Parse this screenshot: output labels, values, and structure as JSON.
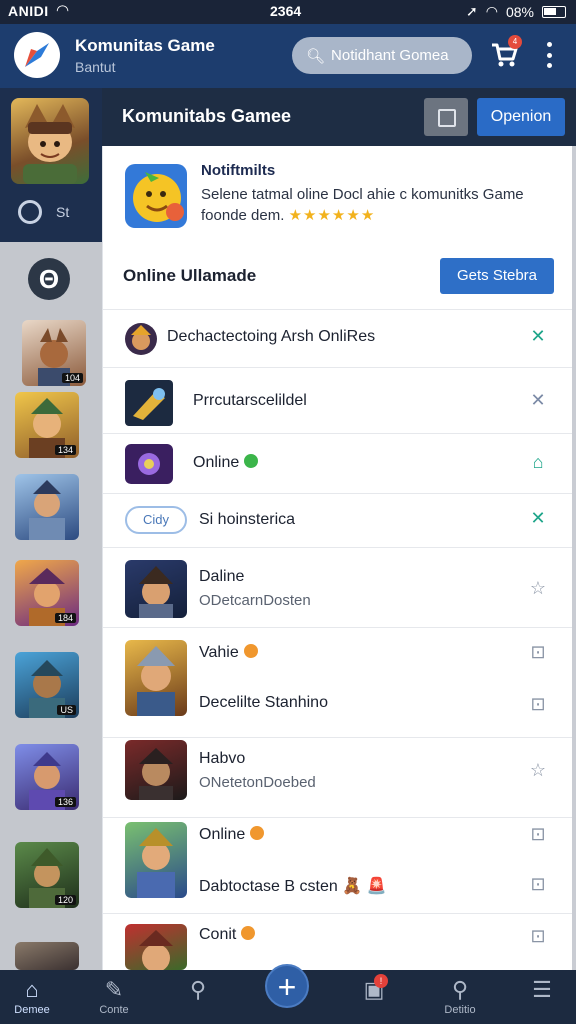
{
  "status_bar": {
    "carrier": "ANIDI",
    "time": "2364",
    "battery": "08%"
  },
  "header": {
    "title": "Komunitas Game",
    "subtitle": "Bantut",
    "search_placeholder": "Notidhant Gomea",
    "cart_badge": "4"
  },
  "rail": {
    "search_label": "St",
    "theta_glyph": "Θ",
    "thumb_levels": [
      "104",
      "134",
      "",
      "184",
      "US",
      "136",
      "120"
    ]
  },
  "section": {
    "title": "Komunitabs Gamee",
    "open_button": "Openion"
  },
  "notification": {
    "title": "Notiftmilts",
    "text": "Selene tatmal oline Docl ahie c komunitks Game foonde dem.",
    "stars": "★★★★★★"
  },
  "online": {
    "title": "Online Ullamade",
    "games_button": "Gets Stebra"
  },
  "rows": [
    {
      "title": "Dechactectoing Arsh OnliRes",
      "action_icon": "✕",
      "action_color": "#1ea58a"
    },
    {
      "title": "Prrcutarscelildel",
      "action_icon": "✕",
      "action_color": "#7b8aa6"
    },
    {
      "title": "Online",
      "status_color": "#3bb54a",
      "action_icon": "⌂",
      "action_color": "#1ea58a"
    },
    {
      "title": "Si hoinsterica",
      "pill_label": "Cidy",
      "action_icon": "✕",
      "action_color": "#1ea58a"
    },
    {
      "title": "Daline",
      "subtitle": "ODetcarnDosten",
      "action_icon": "☆",
      "action_color": "#8a94a5"
    },
    {
      "title": "Vahie",
      "status_color": "#f0972e",
      "action_icon": "⊡",
      "action_color": "#8a94a5"
    },
    {
      "title": "Decelilte Stanhino",
      "action_icon": "⊡",
      "action_color": "#8a94a5"
    },
    {
      "title": "Habvo",
      "subtitle": "ONetetonDoebed",
      "action_icon": "☆",
      "action_color": "#8a94a5"
    },
    {
      "title": "Online",
      "status_color": "#f0972e",
      "action_icon": "⊡",
      "action_color": "#8a94a5"
    },
    {
      "title": "Dabtoctase B csten",
      "extra": "🧸 🚨",
      "action_icon": "⊡",
      "action_color": "#8a94a5"
    },
    {
      "title": "Conit",
      "status_color": "#f0972e",
      "action_icon": "⊡",
      "action_color": "#8a94a5"
    }
  ],
  "bottom_nav": [
    {
      "label": "Demee",
      "icon": "home-icon"
    },
    {
      "label": "Conte",
      "icon": "edit-icon"
    },
    {
      "label": "",
      "icon": "search-icon"
    },
    {
      "label": "",
      "icon": "plus-icon"
    },
    {
      "label": "",
      "icon": "inbox-icon",
      "badge": "!"
    },
    {
      "label": "Detitio",
      "icon": "search-icon"
    },
    {
      "label": "",
      "icon": "list-icon"
    }
  ]
}
